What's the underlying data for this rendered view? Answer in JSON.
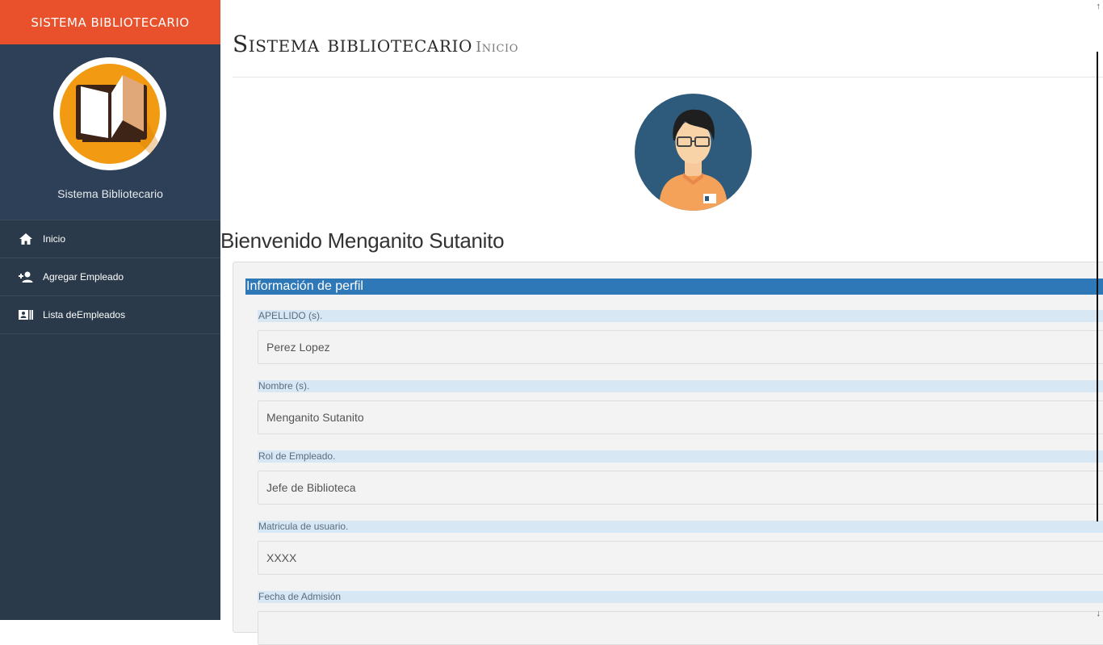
{
  "sidebar": {
    "brand": "SISTEMA BIBLIOTECARIO",
    "logo_icon": "open-book-icon",
    "title": "Sistema Bibliotecario",
    "items": [
      {
        "label": "Inicio",
        "icon": "home-icon"
      },
      {
        "label": "Agregar Empleado",
        "icon": "add-user-icon"
      },
      {
        "label": "Lista deEmpleados",
        "icon": "id-card-icon"
      }
    ]
  },
  "header": {
    "title": "Sistema bibliotecario",
    "subtitle": "Inicio"
  },
  "welcome": "Bienvenido Menganito Sutanito",
  "profile": {
    "heading": "Información de perfil",
    "fields": [
      {
        "label": "APELLIDO (s).",
        "value": "Perez Lopez"
      },
      {
        "label": "Nombre (s).",
        "value": "Menganito Sutanito"
      },
      {
        "label": "Rol de Empleado.",
        "value": "Jefe de Biblioteca"
      },
      {
        "label": "Matricula de usuario.",
        "value": "XXXX"
      },
      {
        "label": "Fecha de Admisión",
        "value": ""
      }
    ]
  },
  "colors": {
    "brand": "#e8512b",
    "sidebar": "#2b3a4a",
    "panel_heading": "#2f78b7",
    "label_bg": "#d7e7f3"
  }
}
